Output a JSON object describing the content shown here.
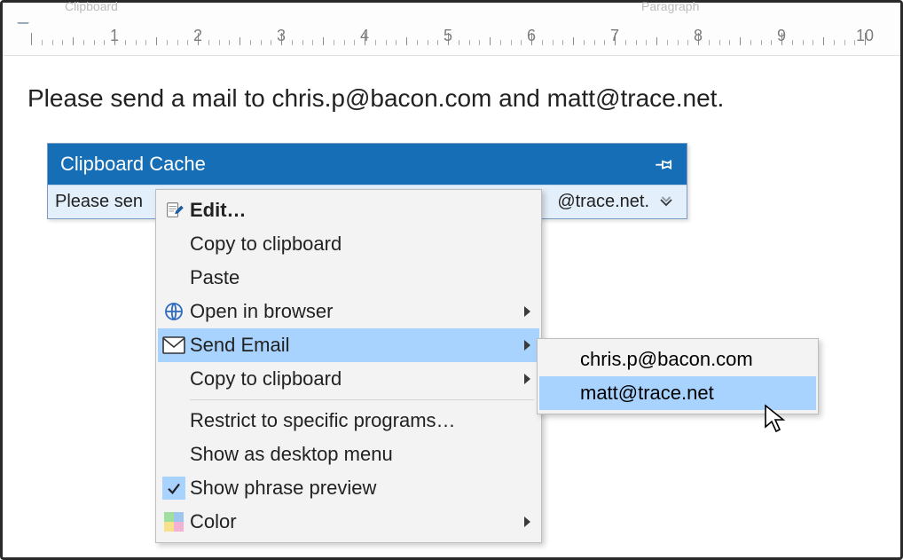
{
  "ribbon_labels": [
    "Clipboard",
    "Paragraph"
  ],
  "ruler_numbers": [
    1,
    2,
    3,
    4,
    5,
    6,
    7,
    8,
    9,
    10
  ],
  "document_text": "Please send a mail to chris.p@bacon.com and matt@trace.net.",
  "panel": {
    "title": "Clipboard Cache",
    "item_left": "Please sen",
    "item_right": "@trace.net."
  },
  "menu": {
    "edit": "Edit…",
    "copy": "Copy to clipboard",
    "paste": "Paste",
    "open_browser": "Open in browser",
    "send_email": "Send Email",
    "copy2": "Copy to clipboard",
    "restrict": "Restrict to specific programs…",
    "desktop_menu": "Show as desktop menu",
    "phrase_preview": "Show phrase preview",
    "color": "Color"
  },
  "submenu": {
    "items": [
      "chris.p@bacon.com",
      "matt@trace.net"
    ]
  }
}
